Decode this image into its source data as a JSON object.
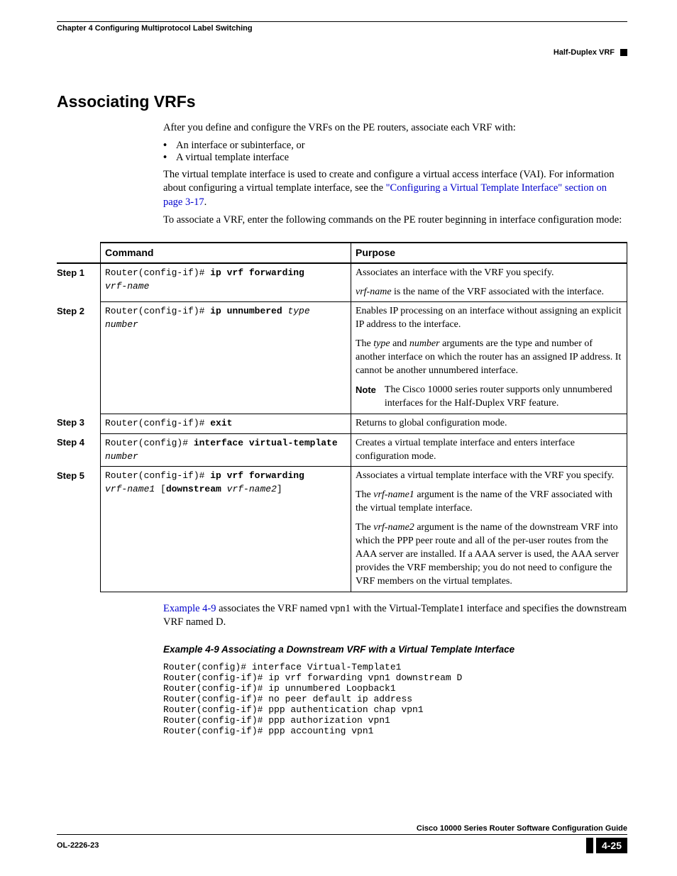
{
  "header": {
    "chapter": "Chapter 4    Configuring Multiprotocol Label Switching",
    "right_label": "Half-Duplex VRF"
  },
  "section_title": "Associating VRFs",
  "intro_para": "After you define and configure the VRFs on the PE routers, associate each VRF with:",
  "bullets": [
    "An interface or subinterface, or",
    "A virtual template interface"
  ],
  "para2_a": "The virtual template interface is used to create and configure a virtual access interface (VAI). For information about configuring a virtual template interface, see the ",
  "para2_link": "\"Configuring a Virtual Template Interface\" section on page 3-17",
  "para2_b": ".",
  "para3": "To associate a VRF, enter the following commands on the PE router beginning in interface configuration mode:",
  "table": {
    "headers": {
      "command": "Command",
      "purpose": "Purpose"
    },
    "rows": [
      {
        "step": "Step 1",
        "cmd_prefix": "Router(config-if)# ",
        "cmd_bold": "ip vrf forwarding",
        "cmd_args": "vrf-name",
        "purpose_p1": "Associates an interface with the VRF you specify.",
        "purpose_p2_i": "vrf-name",
        "purpose_p2_rest": " is the name of the VRF associated with the interface."
      },
      {
        "step": "Step 2",
        "cmd_prefix": "Router(config-if)# ",
        "cmd_bold": "ip unnumbered",
        "cmd_args": " type number",
        "purpose_p1": "Enables IP processing on an interface without assigning an explicit IP address to the interface.",
        "purpose_p2_a": "The ",
        "purpose_p2_i1": "type",
        "purpose_p2_mid": " and ",
        "purpose_p2_i2": "number",
        "purpose_p2_b": " arguments are the type and number of another interface on which the router has an assigned IP address. It cannot be another unnumbered interface.",
        "note_label": "Note",
        "note_text": "The Cisco 10000 series router supports only unnumbered interfaces for the Half-Duplex VRF feature."
      },
      {
        "step": "Step 3",
        "cmd_prefix": "Router(config-if)# ",
        "cmd_bold": "exit",
        "purpose_p1": "Returns to global configuration mode."
      },
      {
        "step": "Step 4",
        "cmd_prefix": "Router(config)# ",
        "cmd_bold": "interface virtual-template",
        "cmd_args": "number",
        "purpose_p1": "Creates a virtual template interface and enters interface configuration mode."
      },
      {
        "step": "Step 5",
        "cmd_prefix": "Router(config-if)# ",
        "cmd_bold": "ip vrf forwarding",
        "cmd_args_a": "vrf-name1",
        "cmd_bold2": "downstream",
        "cmd_args_b": "vrf-name2",
        "purpose_p1": "Associates a virtual template interface with the VRF you specify.",
        "purpose_p2_a": "The ",
        "purpose_p2_i": "vrf-name1",
        "purpose_p2_b": " argument is the name of the VRF associated with the virtual template interface.",
        "purpose_p3_a": "The ",
        "purpose_p3_i": "vrf-name2",
        "purpose_p3_b": " argument is the name of the downstream VRF into which the PPP peer route and all of the per-user routes from the AAA server are installed. If a AAA server is used, the AAA server provides the VRF membership; you do not need to configure the VRF members on the virtual templates."
      }
    ]
  },
  "after_table_link": "Example 4-9",
  "after_table_text": " associates the VRF named vpn1 with the Virtual-Template1 interface and specifies the downstream VRF named D.",
  "example_title": "Example 4-9     Associating a Downstream VRF with a Virtual Template Interface",
  "code": "Router(config)# interface Virtual-Template1\nRouter(config-if)# ip vrf forwarding vpn1 downstream D\nRouter(config-if)# ip unnumbered Loopback1\nRouter(config-if)# no peer default ip address\nRouter(config-if)# ppp authentication chap vpn1\nRouter(config-if)# ppp authorization vpn1\nRouter(config-if)# ppp accounting vpn1",
  "footer": {
    "book_title": "Cisco 10000 Series Router Software Configuration Guide",
    "doc_id": "OL-2226-23",
    "page_num": "4-25"
  }
}
